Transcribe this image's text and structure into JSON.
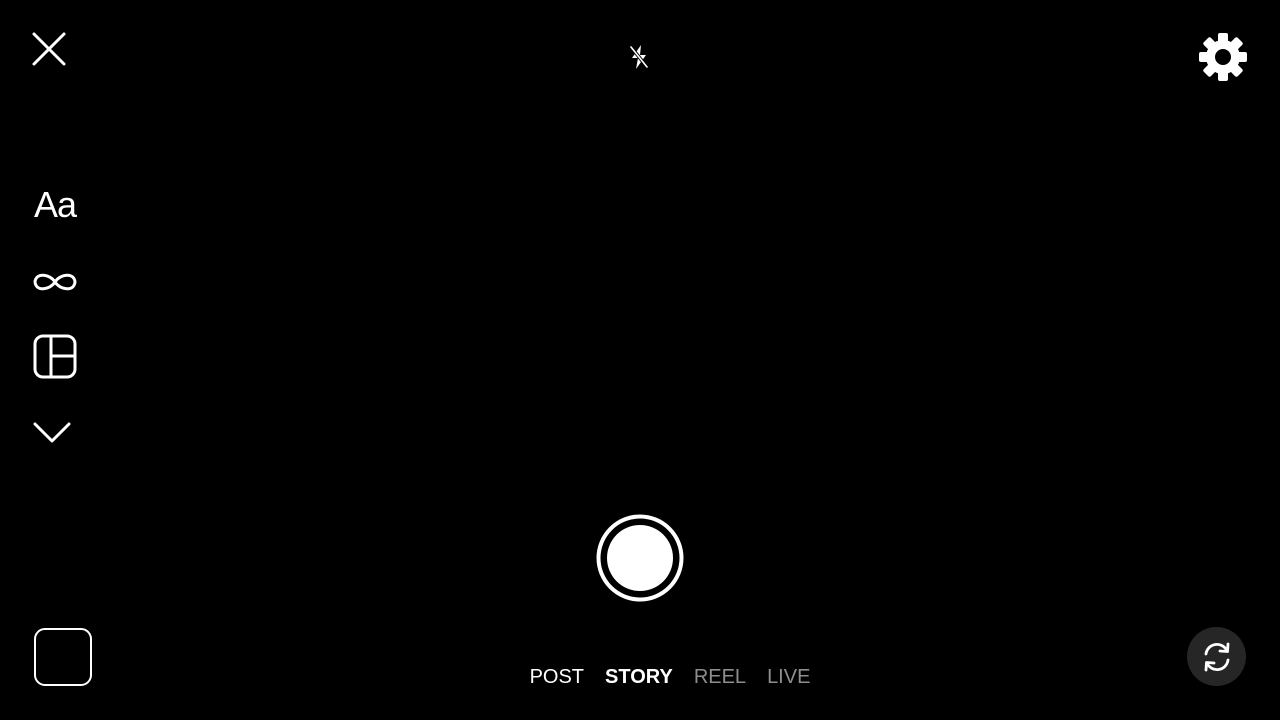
{
  "top_bar": {
    "close_icon": "close-icon",
    "flash_icon": "flash-off-icon",
    "settings_icon": "gear-icon"
  },
  "side_tools": {
    "create_label": "Aa",
    "boomerang_icon": "infinity-icon",
    "layout_icon": "layout-grid-icon",
    "more_icon": "chevron-down-icon"
  },
  "bottom_bar": {
    "gallery_icon": "gallery-thumbnail",
    "shutter_icon": "shutter-button",
    "flip_icon": "camera-flip-icon",
    "modes": [
      {
        "label": "POST",
        "active": false
      },
      {
        "label": "STORY",
        "active": true
      },
      {
        "label": "REEL",
        "active": false
      },
      {
        "label": "LIVE",
        "active": false
      }
    ]
  },
  "colors": {
    "background": "#000000",
    "foreground": "#ffffff",
    "inactive_mode": "#8e8e8e",
    "flip_button_bg": "#262626"
  }
}
